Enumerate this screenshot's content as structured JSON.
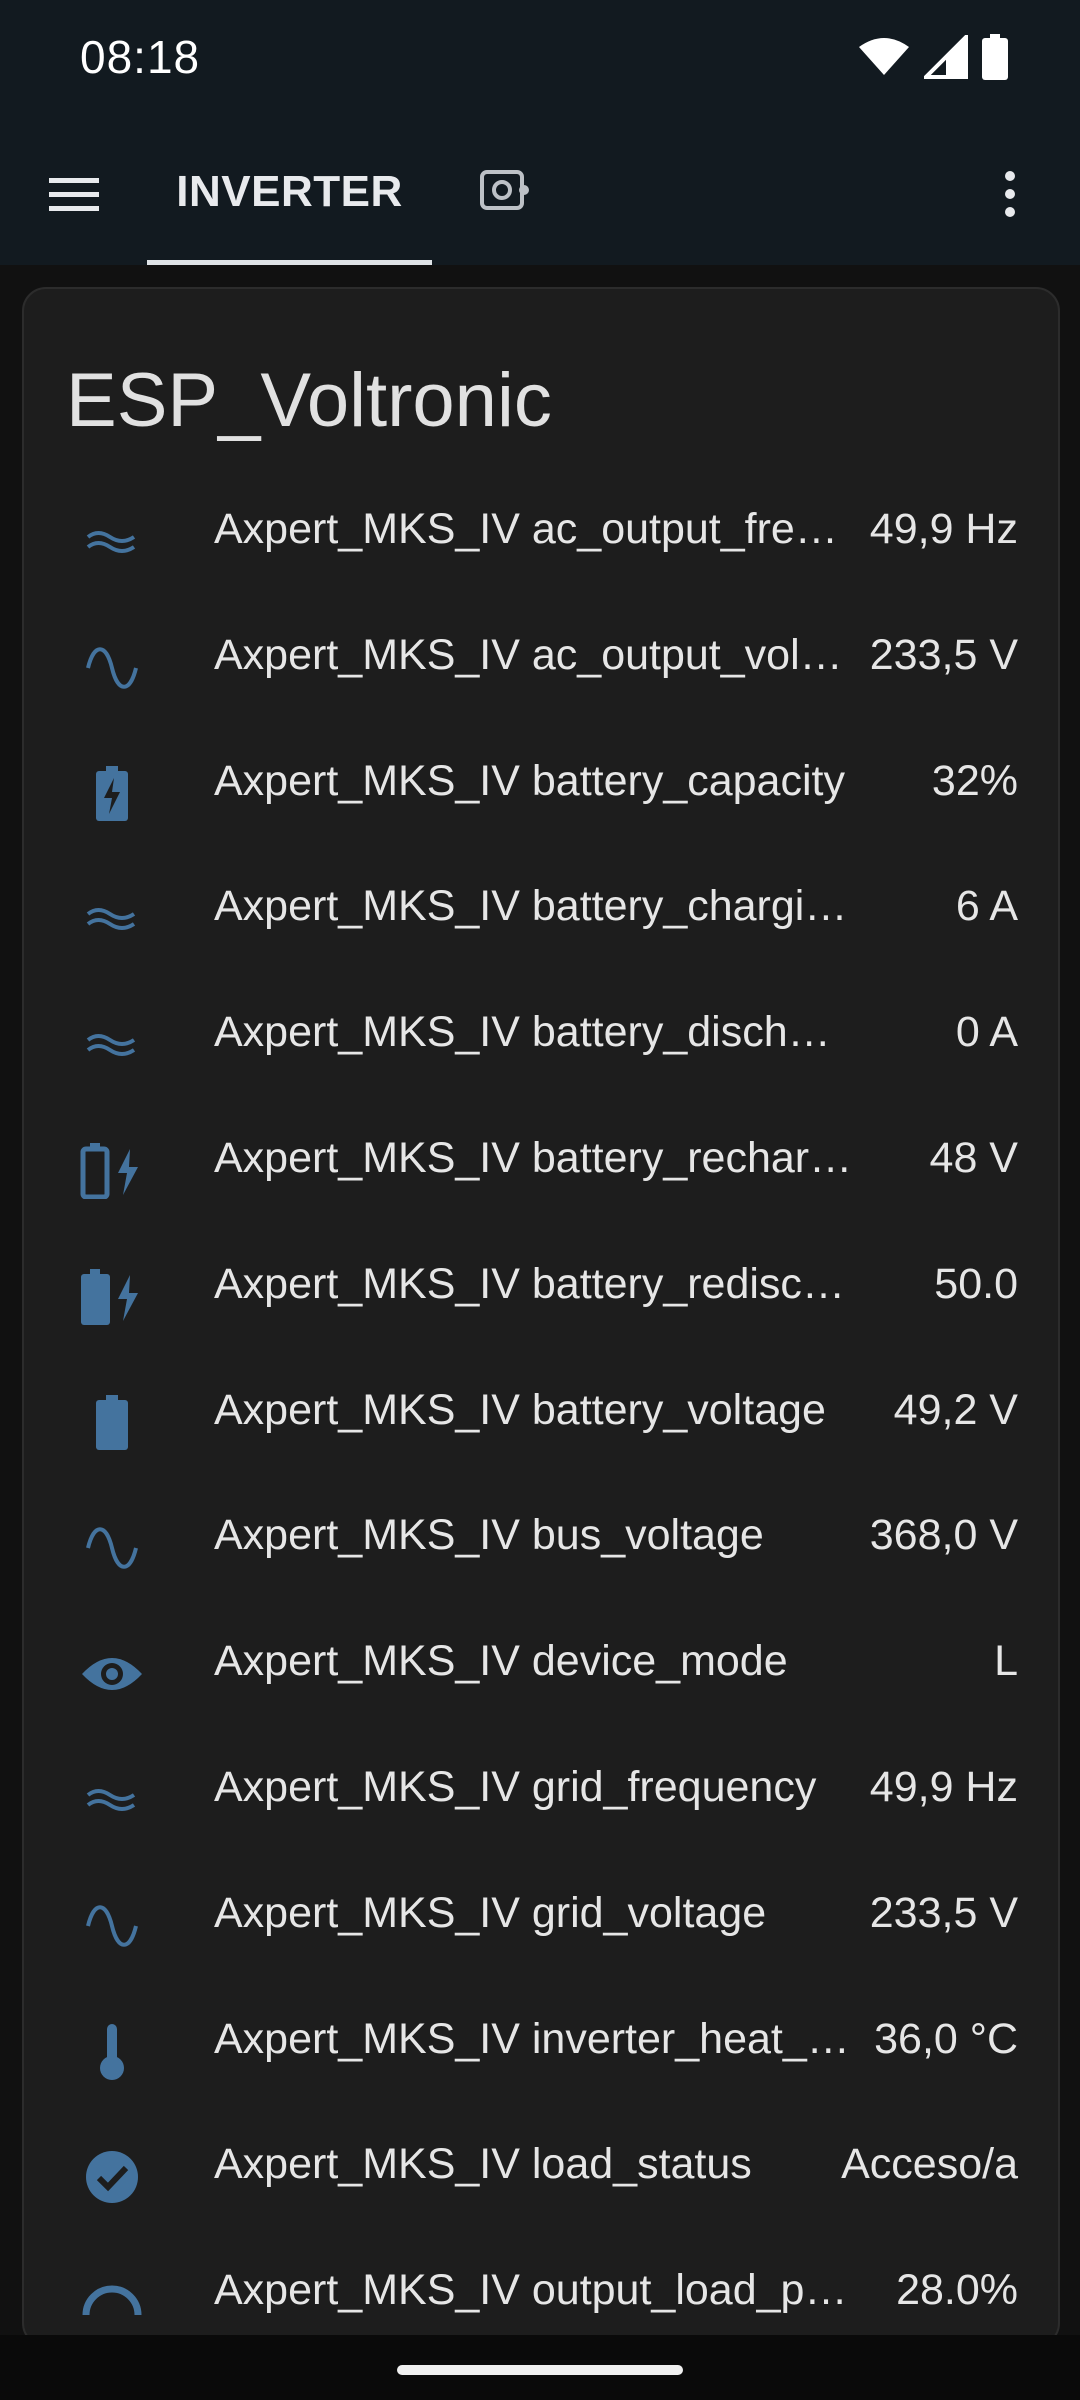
{
  "status_bar": {
    "time": "08:18",
    "icons": [
      "wifi-icon",
      "cell-signal-icon",
      "battery-icon"
    ]
  },
  "app_bar": {
    "menu_icon": "hamburger-menu-icon",
    "tabs": [
      {
        "label": "INVERTER",
        "active": true
      },
      {
        "label": "",
        "icon": "camera-icon",
        "active": false
      }
    ],
    "overflow_icon": "more-vertical-icon"
  },
  "card": {
    "title": "ESP_Voltronic",
    "entities": [
      {
        "name": "Axpert_MKS_IV ac_output_frequency",
        "value": "49,9 Hz",
        "icon": "wave-approx-icon"
      },
      {
        "name": "Axpert_MKS_IV ac_output_voltage",
        "value": "233,5 V",
        "icon": "sine-wave-icon"
      },
      {
        "name": "Axpert_MKS_IV battery_capacity",
        "value": "32%",
        "icon": "battery-charging-icon"
      },
      {
        "name": "Axpert_MKS_IV battery_charging_current",
        "value": "6 A",
        "icon": "wave-approx-icon"
      },
      {
        "name": "Axpert_MKS_IV battery_discharge_current",
        "value": "0 A",
        "icon": "wave-approx-icon"
      },
      {
        "name": "Axpert_MKS_IV battery_recharge_voltage",
        "value": "48 V",
        "icon": "battery-outline-bolt-icon"
      },
      {
        "name": "Axpert_MKS_IV battery_redischarge_voltage",
        "value": "50.0",
        "icon": "battery-bolt-icon"
      },
      {
        "name": "Axpert_MKS_IV battery_voltage",
        "value": "49,2 V",
        "icon": "battery-icon"
      },
      {
        "name": "Axpert_MKS_IV bus_voltage",
        "value": "368,0 V",
        "icon": "sine-wave-icon"
      },
      {
        "name": "Axpert_MKS_IV device_mode",
        "value": "L",
        "icon": "eye-icon"
      },
      {
        "name": "Axpert_MKS_IV grid_frequency",
        "value": "49,9 Hz",
        "icon": "wave-approx-icon"
      },
      {
        "name": "Axpert_MKS_IV grid_voltage",
        "value": "233,5 V",
        "icon": "sine-wave-icon"
      },
      {
        "name": "Axpert_MKS_IV inverter_heat_sink_temperature",
        "value": "36,0 °C",
        "icon": "thermometer-icon"
      },
      {
        "name": "Axpert_MKS_IV load_status",
        "value": "Acceso/a",
        "icon": "check-circle-icon"
      },
      {
        "name": "Axpert_MKS_IV output_load_percent",
        "value": "28.0%",
        "icon": "gauge-icon"
      }
    ]
  },
  "colors": {
    "icon_accent": "#44739e",
    "app_bar_bg": "#121a20",
    "card_bg": "#1d1d1d"
  }
}
